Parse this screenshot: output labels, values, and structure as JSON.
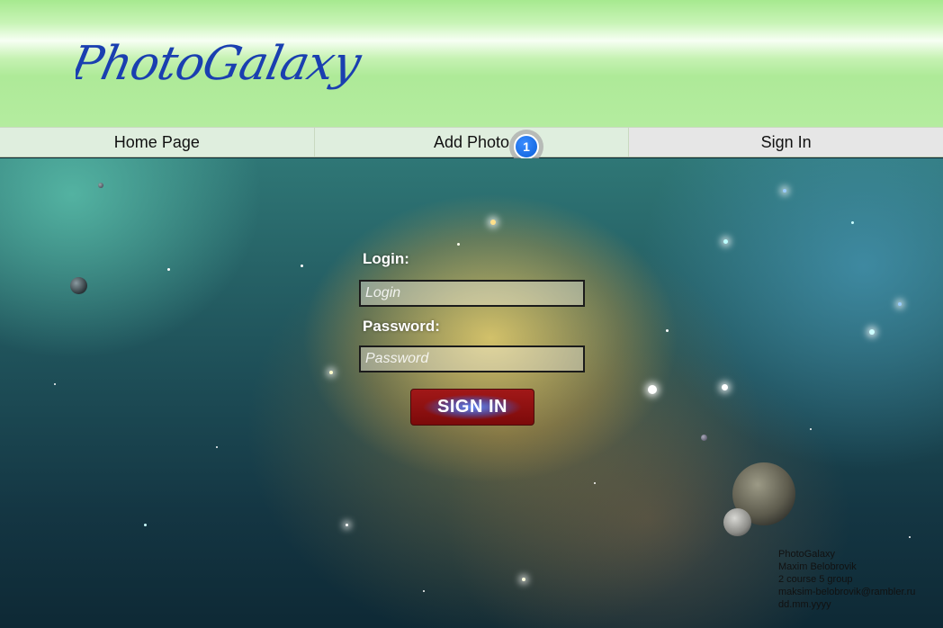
{
  "brand": {
    "logo_text": "PhotoGalaxy"
  },
  "nav": {
    "items": [
      {
        "label": "Home Page"
      },
      {
        "label": "Add Photo"
      },
      {
        "label": "Sign In"
      }
    ],
    "badge_count": "1"
  },
  "form": {
    "login_label": "Login:",
    "login_placeholder": "Login",
    "password_label": "Password:",
    "password_placeholder": "Password",
    "submit_label": "SIGN IN"
  },
  "footer": {
    "lines": [
      "PhotoGalaxy",
      "Maxim Belobrovik",
      "2 course 5 group",
      "maksim-belobrovik@rambler.ru",
      "dd.mm.yyyy"
    ]
  },
  "colors": {
    "header_green": "#aeea98",
    "logo_blue": "#1a3fb0",
    "nav_bg": "#dfeede",
    "button_red": "#a11818",
    "badge_blue": "#0a5fd8"
  }
}
